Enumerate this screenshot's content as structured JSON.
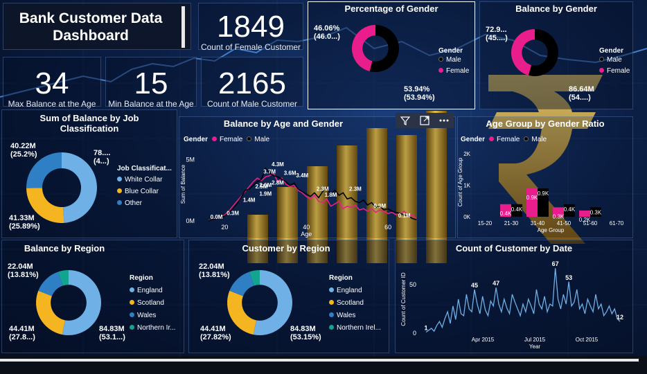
{
  "title": "Bank Customer Data Dashboard",
  "kpis": {
    "female": {
      "value": "1849",
      "label": "Count of Female Customer"
    },
    "max_age_balance": {
      "value": "34",
      "label": "Max Balance at the Age"
    },
    "min_age_balance": {
      "value": "15",
      "label": "Min Balance at the Age"
    },
    "male": {
      "value": "2165",
      "label": "Count of Male Customer"
    }
  },
  "colors": {
    "female": "#e91e8c",
    "male": "#000000",
    "white_collar": "#6fb0e6",
    "blue_collar": "#f4b521",
    "other": "#2f7fc4",
    "northern_ireland": "#13a391",
    "line": "#4a86d6"
  },
  "legend_titles": {
    "gender": "Gender",
    "job": "Job Classificat...",
    "region": "Region"
  },
  "visual_header_icons": [
    "filter-icon",
    "focus-mode-icon",
    "more-options-icon"
  ],
  "chart_data": [
    {
      "type": "pie",
      "style": "donut",
      "title": "Percentage of Gender",
      "legend_title": "Gender",
      "categories": [
        "Male",
        "Female"
      ],
      "values": [
        53.94,
        46.06
      ],
      "data_labels": [
        "53.94% (53.94%)",
        "46.06% (46.0...)"
      ],
      "colors": [
        "#000000",
        "#e91e8c"
      ]
    },
    {
      "type": "pie",
      "style": "donut",
      "title": "Balance by Gender",
      "legend_title": "Gender",
      "categories": [
        "Male",
        "Female"
      ],
      "values": [
        86.64,
        72.9
      ],
      "data_labels": [
        "86.64M (54....)",
        "72.9... (45....)"
      ],
      "colors": [
        "#000000",
        "#e91e8c"
      ]
    },
    {
      "type": "pie",
      "style": "donut",
      "title": "Sum of Balance by Job Classification",
      "legend_title": "Job Classificat...",
      "categories": [
        "White Collar",
        "Blue Collar",
        "Other"
      ],
      "values": [
        78.0,
        41.33,
        40.22
      ],
      "data_labels": [
        "78.... (4...)",
        "41.33M (25.89%)",
        "40.22M (25.2%)"
      ],
      "colors": [
        "#6fb0e6",
        "#f4b521",
        "#2f7fc4"
      ]
    },
    {
      "type": "line",
      "title": "Balance by Age and Gender",
      "legend_title": "Gender",
      "xlabel": "Age",
      "ylabel": "Sum of Balance",
      "x_ticks": [
        "20",
        "40",
        "60"
      ],
      "y_ticks": [
        "0M",
        "5M"
      ],
      "ylim": [
        0,
        6
      ],
      "series": [
        {
          "name": "Female",
          "color": "#e91e8c",
          "x": [
            16,
            17,
            18,
            19,
            20,
            21,
            22,
            23,
            24,
            25,
            26,
            27,
            28,
            29,
            30,
            31,
            32,
            33,
            34,
            35,
            36,
            37,
            38,
            39,
            40,
            41,
            42,
            43,
            44,
            45,
            46,
            47,
            48,
            49,
            50,
            51,
            52,
            53,
            54,
            55,
            56,
            57,
            58,
            59,
            60,
            61,
            62,
            63,
            64,
            65,
            66,
            67
          ],
          "y": [
            0.05,
            0.1,
            0.2,
            0.3,
            0.5,
            0.8,
            1.2,
            1.6,
            2.0,
            2.4,
            2.8,
            3.2,
            3.5,
            3.3,
            3.6,
            3.7,
            3.9,
            3.2,
            3.5,
            3.0,
            2.8,
            2.9,
            2.5,
            2.3,
            2.0,
            1.8,
            2.1,
            1.6,
            1.5,
            1.8,
            1.2,
            1.4,
            1.6,
            1.0,
            1.2,
            1.1,
            1.3,
            0.9,
            1.0,
            0.8,
            1.0,
            0.7,
            0.9,
            0.8,
            0.6,
            0.7,
            0.5,
            0.6,
            0.8,
            0.4,
            0.5,
            0.1
          ]
        },
        {
          "name": "Male",
          "color": "#000000",
          "x": [
            16,
            17,
            18,
            19,
            20,
            21,
            22,
            23,
            24,
            25,
            26,
            27,
            28,
            29,
            30,
            31,
            32,
            33,
            34,
            35,
            36,
            37,
            38,
            39,
            40,
            41,
            42,
            43,
            44,
            45,
            46,
            47,
            48,
            49,
            50,
            51,
            52,
            53,
            54,
            55,
            56,
            57,
            58,
            59,
            60,
            61,
            62,
            63,
            64,
            65,
            66,
            67
          ],
          "y": [
            0.0,
            0.1,
            0.2,
            0.3,
            0.4,
            0.7,
            1.0,
            1.4,
            1.9,
            2.5,
            2.6,
            2.9,
            3.2,
            3.4,
            4.3,
            3.9,
            3.7,
            3.6,
            3.4,
            3.2,
            2.9,
            3.1,
            2.6,
            2.4,
            2.2,
            2.0,
            2.3,
            1.9,
            2.4,
            2.7,
            2.2,
            2.5,
            2.1,
            2.3,
            1.8,
            1.9,
            1.6,
            1.5,
            1.7,
            1.3,
            1.5,
            1.1,
            1.2,
            0.9,
            1.0,
            0.8,
            0.7,
            0.6,
            0.5,
            0.4,
            0.2,
            0.1
          ]
        }
      ],
      "data_labels": [
        "0.0M",
        "0.3M",
        "1.4M",
        "1.9M",
        "2.5M",
        "2.6M",
        "2.8M",
        "3.7M",
        "4.3M",
        "3.6M",
        "3.4M",
        "2.3M",
        "1.8M",
        "2.3M",
        "0.9M",
        "0.1M"
      ]
    },
    {
      "type": "bar",
      "title": "Age Group by Gender Ratio",
      "legend_title": "Gender",
      "xlabel": "Age Group",
      "ylabel": "Count of Age Group",
      "categories": [
        "15-20",
        "21-30",
        "31-40",
        "41-50",
        "51-60",
        "61-70"
      ],
      "y_ticks": [
        "0K",
        "1K",
        "2K"
      ],
      "ylim": [
        0,
        2.2
      ],
      "series": [
        {
          "name": "Female",
          "color": "#e91e8c",
          "values": [
            0.0,
            0.4,
            0.9,
            0.3,
            0.2,
            0.0
          ],
          "labels": [
            "",
            "0.4K",
            "0.9K",
            "0.3K",
            "0.2K",
            ""
          ]
        },
        {
          "name": "Male",
          "color": "#000000",
          "values": [
            0.0,
            0.4,
            0.9,
            0.4,
            0.3,
            0.0
          ],
          "labels": [
            "",
            "0.4K",
            "0.9K",
            "0.4K",
            "0.3K",
            ""
          ]
        }
      ]
    },
    {
      "type": "pie",
      "style": "donut",
      "title": "Balance by Region",
      "legend_title": "Region",
      "categories": [
        "England",
        "Scotland",
        "Wales",
        "Northern Ir..."
      ],
      "values": [
        84.83,
        44.41,
        22.04,
        8.3
      ],
      "data_labels": [
        "84.83M (53.1...)",
        "44.41M (27.8...)",
        "22.04M (13.81%)"
      ],
      "colors": [
        "#6fb0e6",
        "#f4b521",
        "#2f7fc4",
        "#13a391"
      ]
    },
    {
      "type": "pie",
      "style": "donut",
      "title": "Customer by Region",
      "legend_title": "Region",
      "categories": [
        "England",
        "Scotland",
        "Wales",
        "Northern Irel..."
      ],
      "values": [
        84.83,
        44.41,
        22.04,
        8.3
      ],
      "data_labels": [
        "84.83M (53.15%)",
        "44.41M (27.82%)",
        "22.04M (13.81%)"
      ],
      "colors": [
        "#6fb0e6",
        "#f4b521",
        "#2f7fc4",
        "#13a391"
      ]
    },
    {
      "type": "line",
      "title": "Count of Customer by Date",
      "xlabel": "Year",
      "ylabel": "Count of Customer ID",
      "x_ticks": [
        "Apr 2015",
        "Jul 2015",
        "Oct 2015"
      ],
      "y_ticks": [
        "0",
        "50"
      ],
      "ylim": [
        0,
        70
      ],
      "series": [
        {
          "name": "",
          "color": "#6fb0e6",
          "values": [
            1,
            3,
            5,
            2,
            8,
            12,
            6,
            15,
            22,
            10,
            28,
            14,
            35,
            20,
            18,
            40,
            25,
            22,
            45,
            30,
            20,
            38,
            24,
            18,
            33,
            28,
            47,
            30,
            22,
            35,
            26,
            20,
            40,
            32,
            25,
            18,
            30,
            22,
            35,
            28,
            20,
            45,
            30,
            25,
            38,
            22,
            30,
            28,
            67,
            35,
            25,
            40,
            30,
            53,
            28,
            32,
            45,
            25,
            30,
            20,
            35,
            28,
            22,
            40,
            25,
            30,
            18,
            22,
            28,
            20,
            25,
            15,
            12
          ],
          "point_labels": {
            "first": "1",
            "peak1": "45",
            "peak2": "47",
            "peak3": "67",
            "peak4": "53",
            "last": "12"
          }
        }
      ]
    }
  ]
}
